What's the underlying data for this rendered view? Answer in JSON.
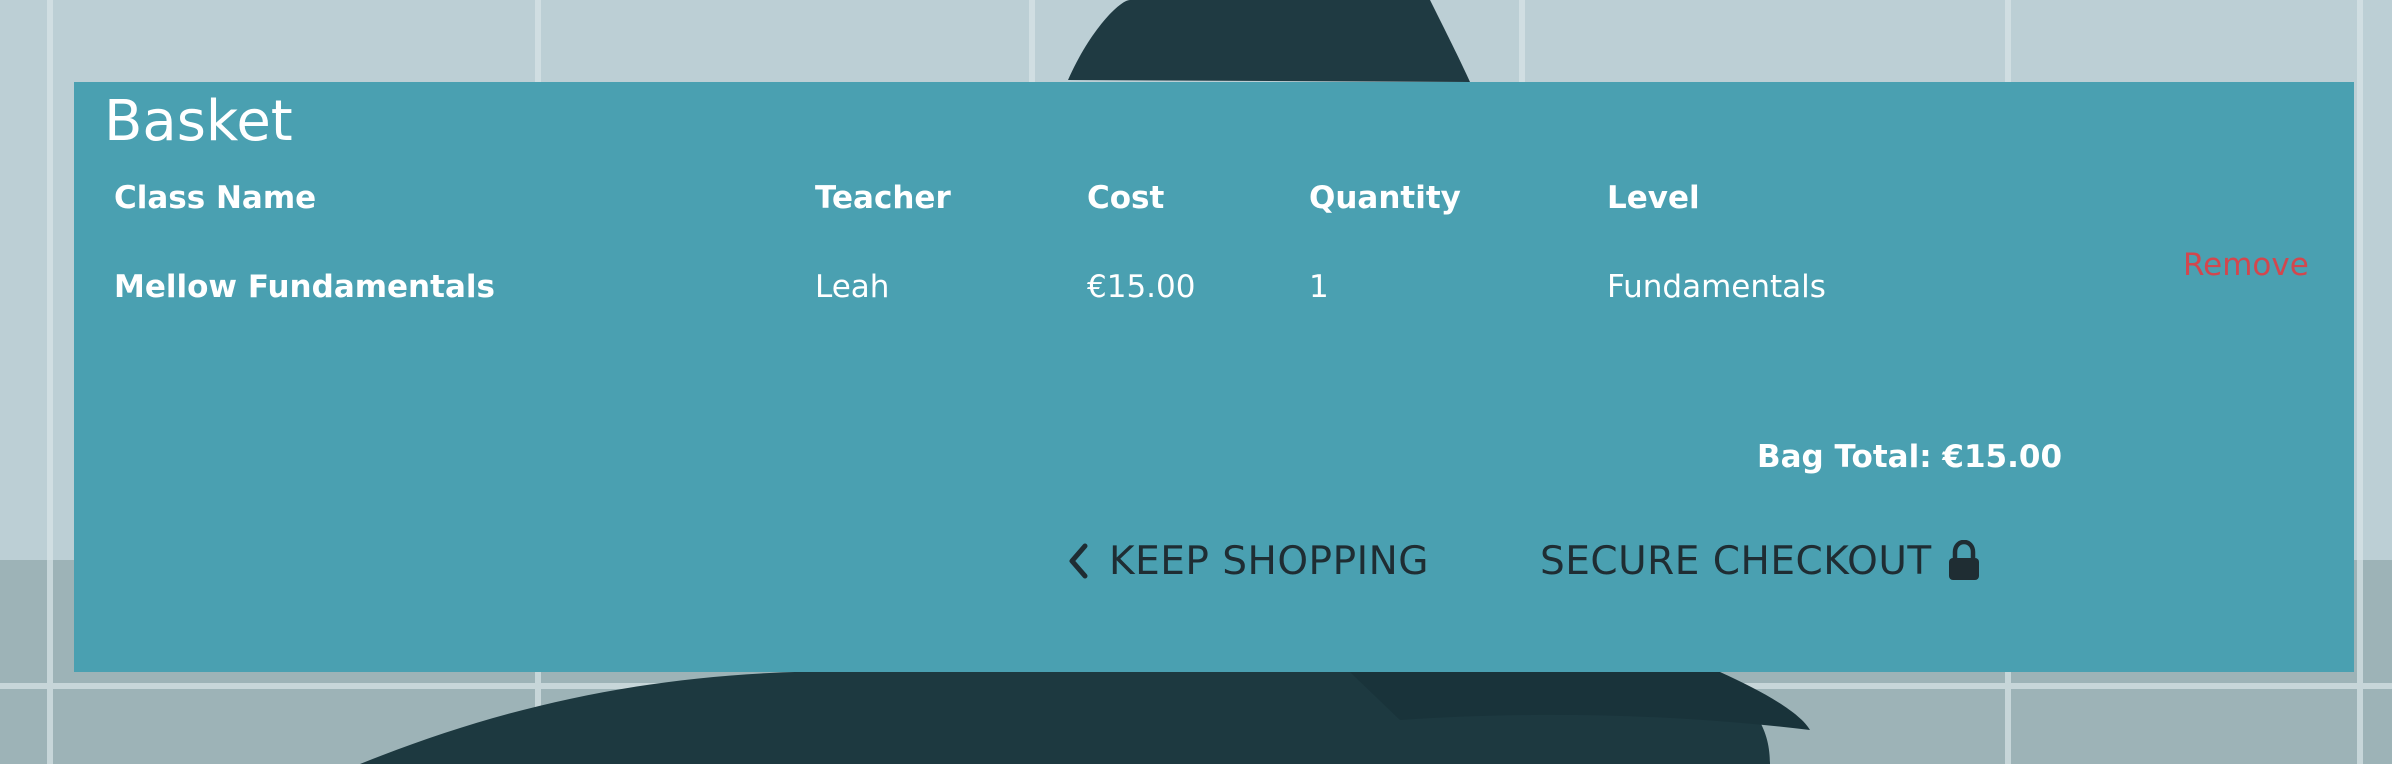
{
  "basket": {
    "title": "Basket",
    "columns": [
      "Class Name",
      "Teacher",
      "Cost",
      "Quantity",
      "Level"
    ],
    "items": [
      {
        "class_name": "Mellow Fundamentals",
        "teacher": "Leah",
        "cost": "€15.00",
        "quantity": "1",
        "level": "Fundamentals",
        "remove_label": "Remove"
      }
    ],
    "bag_total": "Bag Total: €15.00",
    "keep_shopping_label": "KEEP SHOPPING",
    "secure_checkout_label": "SECURE CHECKOUT"
  },
  "icons": {
    "keep_shopping": "chevron-left-icon",
    "secure_checkout": "lock-icon"
  },
  "colors": {
    "panel": "#4aa0b1",
    "remove": "#d2474e",
    "button_text": "#1f2d33"
  }
}
